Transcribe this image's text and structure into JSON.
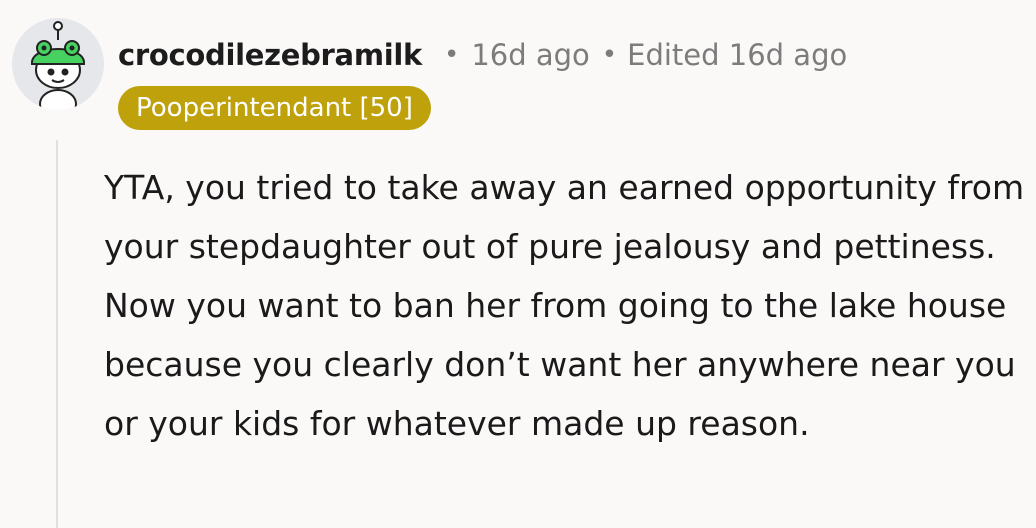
{
  "comment": {
    "author": "crocodilezebramilk",
    "separator": "•",
    "age": "16d ago",
    "edited": "Edited 16d ago",
    "flair": "Pooperintendant [50]",
    "body": "YTA, you tried to take away an earned opportunity from your stepdaughter out of pure jealousy and pettiness. Now you want to ban her from going to the lake house because you clearly don’t want her anywhere near you or your kids for whatever made up reason."
  },
  "colors": {
    "background": "#fbf9f8",
    "flair_background": "#bfa10c",
    "meta_text": "#7c7c7c",
    "avatar_accent": "#46d160"
  },
  "icons": {
    "avatar": "snoo-avatar-frog-hat"
  }
}
